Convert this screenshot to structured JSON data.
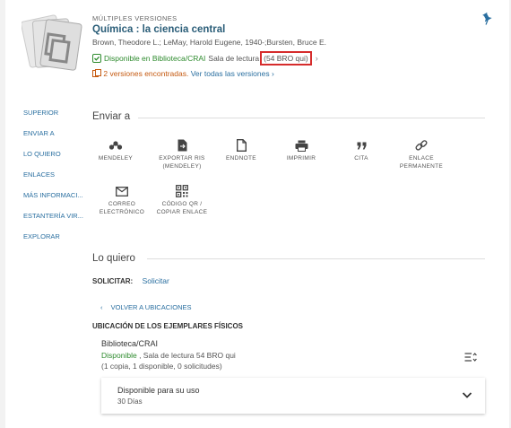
{
  "record": {
    "label": "MÚLTIPLES VERSIONES",
    "title": "Química : la ciencia central",
    "authors": "Brown, Theodore L.; LeMay, Harold Eugene, 1940-;Bursten, Bruce E.",
    "availability_status": "Disponible en Biblioteca/CRAI",
    "availability_location": "Sala de lectura",
    "call_number": "(54 BRO qui)",
    "versions_count": "2 versiones encontradas.",
    "versions_link": "Ver todas las versiones",
    "versions_arrow": "›"
  },
  "sidenav": {
    "items": [
      "SUPERIOR",
      "ENVIAR A",
      "LO QUIERO",
      "ENLACES",
      "MÁS INFORMACI...",
      "ESTANTERÍA VIR...",
      "EXPLORAR"
    ]
  },
  "enviar": {
    "title": "Enviar a",
    "actions": [
      {
        "label": "MENDELEY",
        "icon": "mendeley-icon"
      },
      {
        "label": "EXPORTAR RIS (MENDELEY)",
        "icon": "file-export-icon"
      },
      {
        "label": "ENDNOTE",
        "icon": "document-icon"
      },
      {
        "label": "IMPRIMIR",
        "icon": "printer-icon"
      },
      {
        "label": "CITA",
        "icon": "quote-icon"
      },
      {
        "label": "ENLACE PERMANENTE",
        "icon": "link-icon"
      },
      {
        "label": "CORREO ELECTRÓNICO",
        "icon": "mail-icon"
      },
      {
        "label": "CÓDIGO QR / COPIAR ENLACE",
        "icon": "qr-code-icon"
      }
    ]
  },
  "loquiero": {
    "title": "Lo quiero",
    "solicitar_label": "SOLICITAR:",
    "solicitar_link": "Solicitar",
    "back_label": "VOLVER A UBICACIONES",
    "ubicacion_title": "UBICACIÓN DE LOS EJEMPLARES FÍSICOS",
    "location_name": "Biblioteca/CRAI",
    "location_status": "Disponible",
    "location_detail": ", Sala de lectura 54 BRO qui",
    "location_copies": "(1 copia, 1 disponible, 0 solicitudes)",
    "item_title": "Disponible para su uso",
    "item_sub": "30 Días"
  },
  "colors": {
    "accent": "#2a6fa0",
    "title": "#2a5d78",
    "available": "#2e8b2e",
    "highlight_box": "#d62c2c",
    "versions_orange": "#c55a11"
  }
}
